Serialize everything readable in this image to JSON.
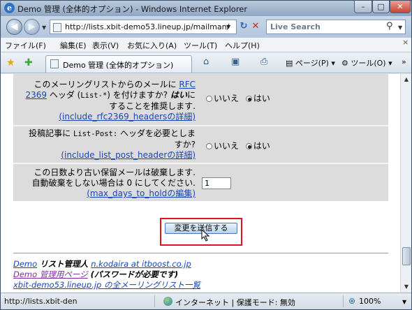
{
  "window": {
    "title": "Demo 管理 (全体的オプション) - Windows Internet Explorer",
    "min_label": "–",
    "max_label": "□",
    "close_label": "✕"
  },
  "nav": {
    "back_glyph": "◀",
    "forward_glyph": "▶",
    "url": "http://lists.xbit-demo53.lineup.jp/mailman/",
    "search_placeholder": "Live Search",
    "refresh_glyph": "↻",
    "stop_glyph": "✕"
  },
  "menu": [
    "ファイル(F)",
    "編集(E)",
    "表示(V)",
    "お気に入り(A)",
    "ツール(T)",
    "ヘルプ(H)"
  ],
  "menu_close": "×",
  "tab": {
    "title": "Demo 管理 (全体的オプション)"
  },
  "commands": {
    "home": "⌂",
    "feeds": "▣",
    "print": "⎙",
    "page": "ページ(P)",
    "tools": "ツール(O)",
    "more": "»"
  },
  "options": [
    {
      "lines": [
        "このメーリングリストからのメールに",
        "ヘッダ (List-*) を付けますか? はいに",
        "することを推奨します."
      ],
      "rfc_link": "RFC",
      "rfc_link2": "2369",
      "header_prefix": " ヘッダ (",
      "header_code": "List-*",
      "header_suffix": ") を付けますか? ",
      "header_em": "はい",
      "header_tail": "に",
      "detail_var": "(include_rfc2369_headers",
      "detail_tail": "の詳細)",
      "radio_no": "いいえ",
      "radio_yes": "はい",
      "selected": "はい"
    },
    {
      "line1": "投稿記事に",
      "code": "List-Post:",
      "line1_tail": " ヘッダを必要としま",
      "line2": "すか?",
      "detail_var": "(include_list_post_header",
      "detail_tail": "の詳細)",
      "radio_no": "いいえ",
      "radio_yes": "はい",
      "selected": "はい"
    },
    {
      "line1": "この日数より古い保留メールは破棄します.",
      "line2": "自動破棄をしない場合は 0 にしてください.",
      "detail_var": "(max_days_to_hold",
      "detail_tail": "の編集)",
      "value": "1"
    }
  ],
  "submit_label": "変更を送信する",
  "footer": {
    "list_name": "Demo",
    "admin_label": " リスト管理人 ",
    "admin_email": "n.kodaira at itboost.co.jp",
    "admin_page_link": "Demo 管理用ページ",
    "admin_page_note": " (パスワードが必要です)",
    "overview_link": "xbit-demo53.lineup.jp の全メーリングリスト一覧"
  },
  "status": {
    "text": "http://lists.xbit-den",
    "zone": "インターネット | 保護モード: 無効",
    "zoom": "100%"
  }
}
